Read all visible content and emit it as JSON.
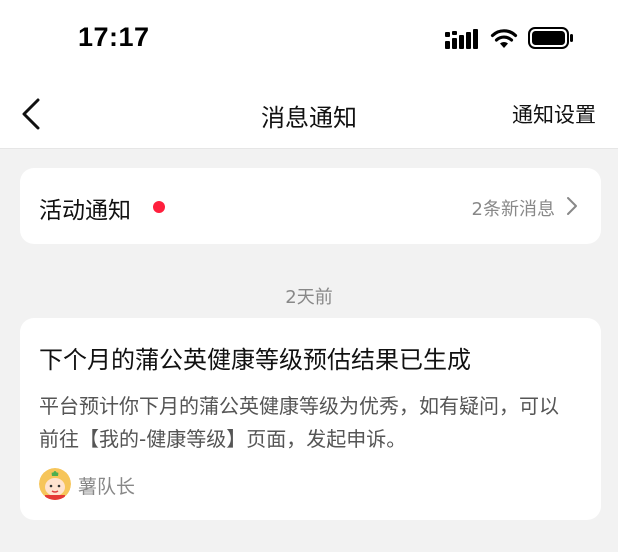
{
  "status_bar": {
    "time": "17:17",
    "icons": [
      "signal-icon",
      "wifi-icon",
      "battery-icon"
    ]
  },
  "nav": {
    "back_icon": "back-arrow-icon",
    "title": "消息通知",
    "settings_label": "通知设置"
  },
  "activity": {
    "title": "活动通知",
    "unread_dot_color": "#ff1f3d",
    "count_text": "2条新消息",
    "chevron_icon": "chevron-right-icon"
  },
  "message_group": {
    "time_label": "2天前",
    "messages": [
      {
        "title": "下个月的蒲公英健康等级预估结果已生成",
        "body": "平台预计你下月的蒲公英健康等级为优秀，如有疑问，可以前往【我的-健康等级】页面，发起申诉。",
        "author": "薯队长",
        "avatar_icon": "avatar-icon"
      }
    ]
  },
  "colors": {
    "background": "#f2f2f2",
    "card": "#ffffff",
    "accent_red": "#ff1f3d",
    "secondary_text": "#888888"
  }
}
